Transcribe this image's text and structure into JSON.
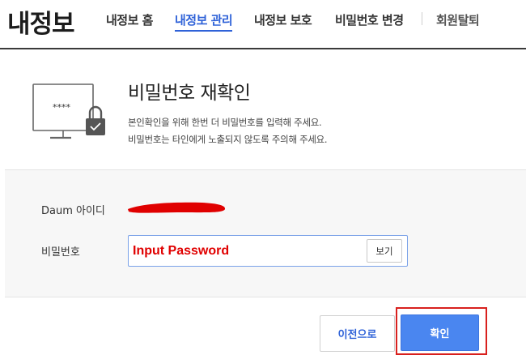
{
  "header": {
    "logo": "내정보",
    "nav": [
      {
        "label": "내정보 홈"
      },
      {
        "label": "내정보 관리"
      },
      {
        "label": "내정보 보호"
      },
      {
        "label": "비밀번호 변경"
      },
      {
        "label": "회원탈퇴"
      }
    ],
    "active_index": 1
  },
  "intro": {
    "icon": "computer-lock-icon",
    "screen_text": "****",
    "title": "비밀번호 재확인",
    "desc_line1": "본인확인을 위해 한번 더 비밀번호를 입력해 주세요.",
    "desc_line2": "비밀번호는 타인에게 노출되지 않도록 주의해 주세요."
  },
  "form": {
    "id_label": "Daum 아이디",
    "id_value_redacted": true,
    "password_label": "비밀번호",
    "password_placeholder": "Input Password",
    "show_button": "보기"
  },
  "buttons": {
    "prev": "이전으로",
    "confirm": "확인"
  },
  "colors": {
    "accent": "#2f62d8",
    "confirm_bg": "#4a86f0",
    "highlight_border": "#d8201d",
    "redaction": "#e00000"
  }
}
